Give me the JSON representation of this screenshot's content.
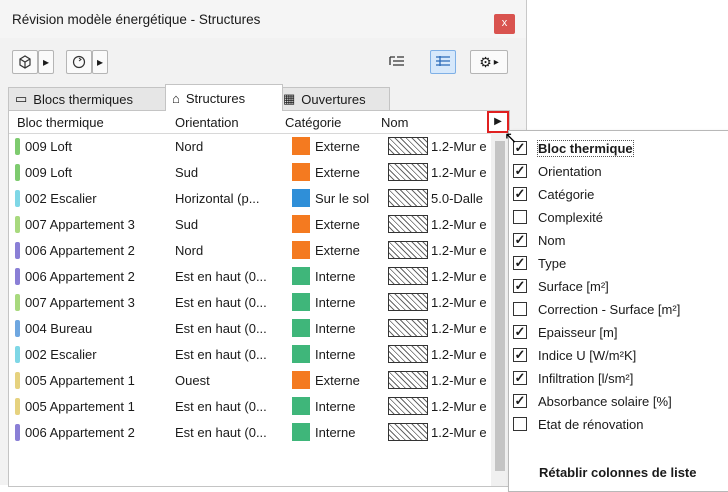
{
  "window": {
    "title": "Révision modèle énergétique - Structures",
    "close_label": "x"
  },
  "toolbar": {
    "view_icon": "cube-icon",
    "arrow1": "▸",
    "refresh_icon": "refresh-icon",
    "arrow2": "▸",
    "list_icon": "tree-list-icon",
    "detail_icon": "detail-list-icon",
    "gear_icon": "gear-icon",
    "arrow3": "▸"
  },
  "tabs": [
    {
      "label": "Blocs thermiques",
      "icon": "▭",
      "active": false
    },
    {
      "label": "Structures",
      "icon": "⌂",
      "active": true
    },
    {
      "label": "Ouvertures",
      "icon": "▦",
      "active": false
    }
  ],
  "table": {
    "headers": [
      "Bloc thermique",
      "Orientation",
      "Catégorie",
      "Nom"
    ],
    "rows": [
      {
        "bloc": "009 Loft",
        "orientation": "Nord",
        "categorie": "Externe",
        "nom": "1.2-Mur e",
        "bar": "#7ecb6f",
        "sw": "#f47a20"
      },
      {
        "bloc": "009 Loft",
        "orientation": "Sud",
        "categorie": "Externe",
        "nom": "1.2-Mur e",
        "bar": "#7ecb6f",
        "sw": "#f47a20"
      },
      {
        "bloc": "002 Escalier",
        "orientation": "Horizontal (p...",
        "categorie": "Sur le sol",
        "nom": "5.0-Dalle",
        "bar": "#7fd7e6",
        "sw": "#2f8fd8"
      },
      {
        "bloc": "007 Appartement 3",
        "orientation": "Sud",
        "categorie": "Externe",
        "nom": "1.2-Mur e",
        "bar": "#a8d97e",
        "sw": "#f47a20"
      },
      {
        "bloc": "006 Appartement 2",
        "orientation": "Nord",
        "categorie": "Externe",
        "nom": "1.2-Mur e",
        "bar": "#8a7fd6",
        "sw": "#f47a20"
      },
      {
        "bloc": "006 Appartement 2",
        "orientation": "Est en haut (0...",
        "categorie": "Interne",
        "nom": "1.2-Mur e",
        "bar": "#8a7fd6",
        "sw": "#3fb67a"
      },
      {
        "bloc": "007 Appartement 3",
        "orientation": "Est en haut (0...",
        "categorie": "Interne",
        "nom": "1.2-Mur e",
        "bar": "#a8d97e",
        "sw": "#3fb67a"
      },
      {
        "bloc": "004 Bureau",
        "orientation": "Est en haut (0...",
        "categorie": "Interne",
        "nom": "1.2-Mur e",
        "bar": "#6fa7e0",
        "sw": "#3fb67a"
      },
      {
        "bloc": "002 Escalier",
        "orientation": "Est en haut (0...",
        "categorie": "Interne",
        "nom": "1.2-Mur e",
        "bar": "#7fd7e6",
        "sw": "#3fb67a"
      },
      {
        "bloc": "005 Appartement 1",
        "orientation": "Ouest",
        "categorie": "Externe",
        "nom": "1.2-Mur e",
        "bar": "#e6d27f",
        "sw": "#f47a20"
      },
      {
        "bloc": "005 Appartement 1",
        "orientation": "Est en haut (0...",
        "categorie": "Interne",
        "nom": "1.2-Mur e",
        "bar": "#e6d27f",
        "sw": "#3fb67a"
      },
      {
        "bloc": "006 Appartement 2",
        "orientation": "Est en haut (0...",
        "categorie": "Interne",
        "nom": "1.2-Mur e",
        "bar": "#8a7fd6",
        "sw": "#3fb67a"
      }
    ]
  },
  "menu": {
    "items": [
      {
        "label": "Bloc thermique",
        "checked": true
      },
      {
        "label": "Orientation",
        "checked": true
      },
      {
        "label": "Catégorie",
        "checked": true
      },
      {
        "label": "Complexité",
        "checked": false
      },
      {
        "label": "Nom",
        "checked": true
      },
      {
        "label": "Type",
        "checked": true
      },
      {
        "label": "Surface [m²]",
        "checked": true
      },
      {
        "label": "Correction - Surface [m²]",
        "checked": false
      },
      {
        "label": "Epaisseur [m]",
        "checked": true
      },
      {
        "label": "Indice U [W/m²K]",
        "checked": true
      },
      {
        "label": "Infiltration [l/sm²]",
        "checked": true
      },
      {
        "label": "Absorbance solaire [%]",
        "checked": true
      },
      {
        "label": "Etat de rénovation",
        "checked": false
      }
    ],
    "reset_label": "Rétablir colonnes de liste",
    "check_mark": "✓"
  }
}
